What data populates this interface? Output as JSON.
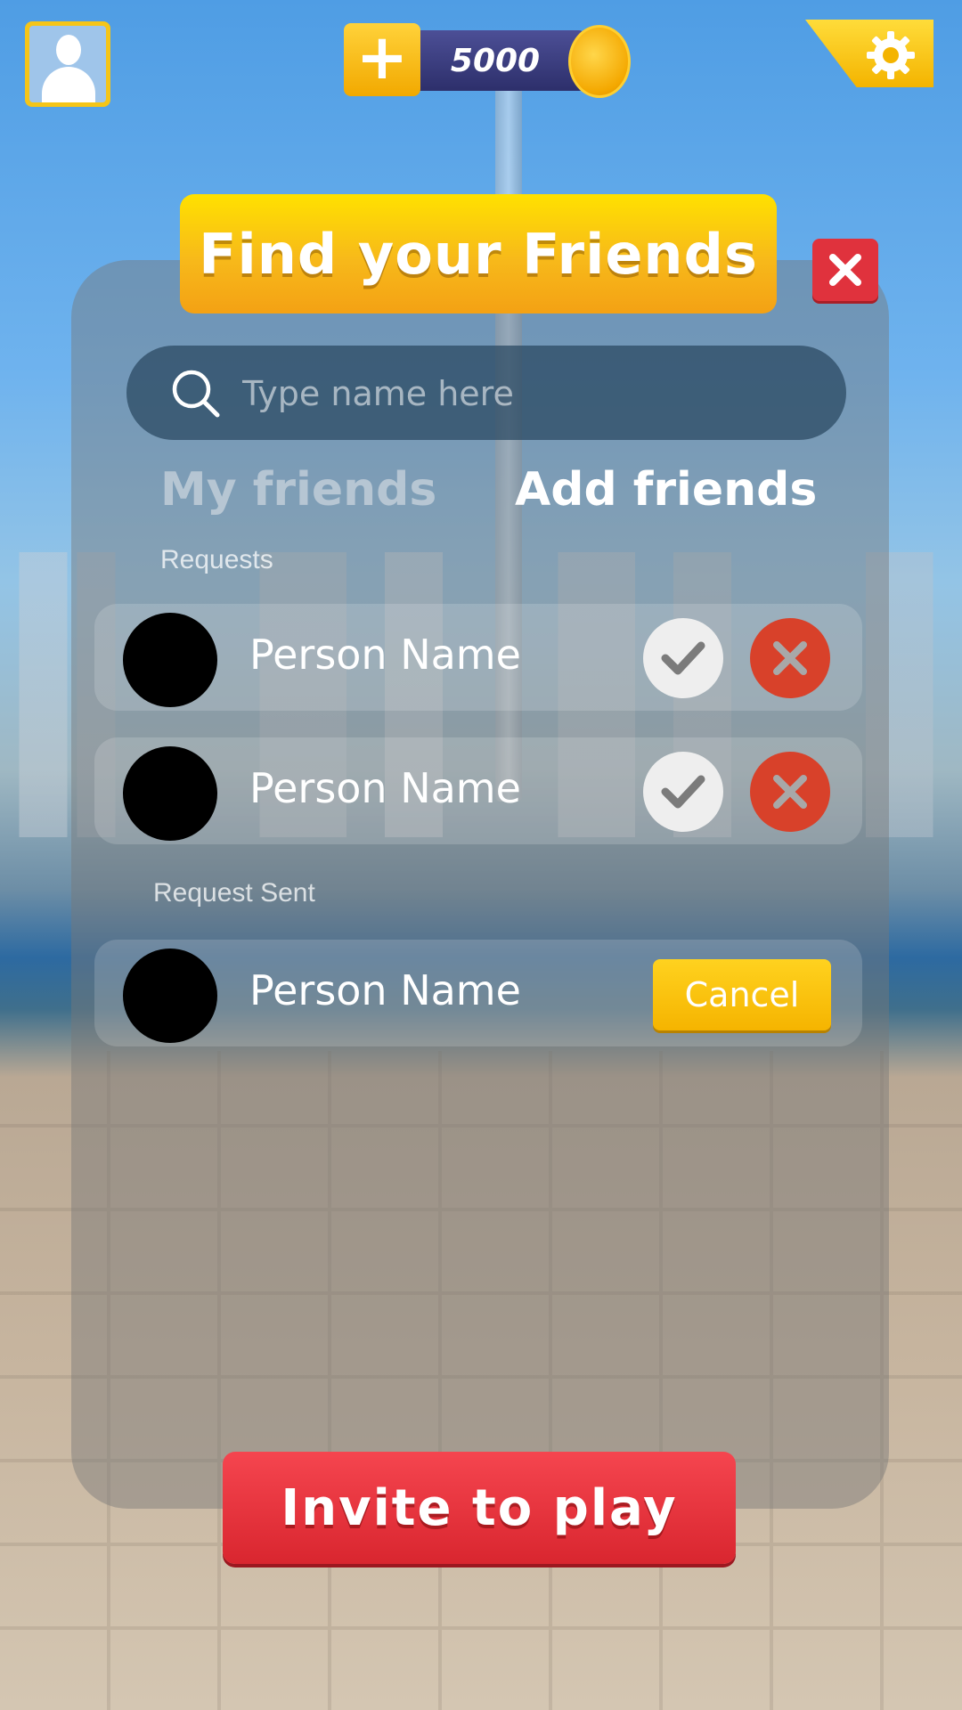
{
  "header": {
    "coins": "5000",
    "add_coins_icon": "plus-icon",
    "coin_icon": "coin-icon",
    "profile_icon": "user-icon",
    "settings_icon": "gear-icon"
  },
  "dialog": {
    "title": "Find your Friends",
    "close_icon": "close-icon",
    "search": {
      "placeholder": "Type name here",
      "value": "",
      "icon": "search-icon"
    },
    "tabs": [
      {
        "label": "My friends",
        "active": false
      },
      {
        "label": "Add friends",
        "active": true
      }
    ],
    "requests_label": "Requests",
    "requests": [
      {
        "name": "Person Name"
      },
      {
        "name": "Person Name"
      }
    ],
    "sent_label": "Request Sent",
    "sent": [
      {
        "name": "Person Name",
        "action": "Cancel"
      }
    ],
    "invite_label": "Invite to play"
  },
  "colors": {
    "banner_yellow": "#f7b91a",
    "close_red": "#e0323d",
    "reject_red": "#d8412a",
    "invite_red": "#e0303a",
    "cancel_yellow": "#ffc90f"
  }
}
